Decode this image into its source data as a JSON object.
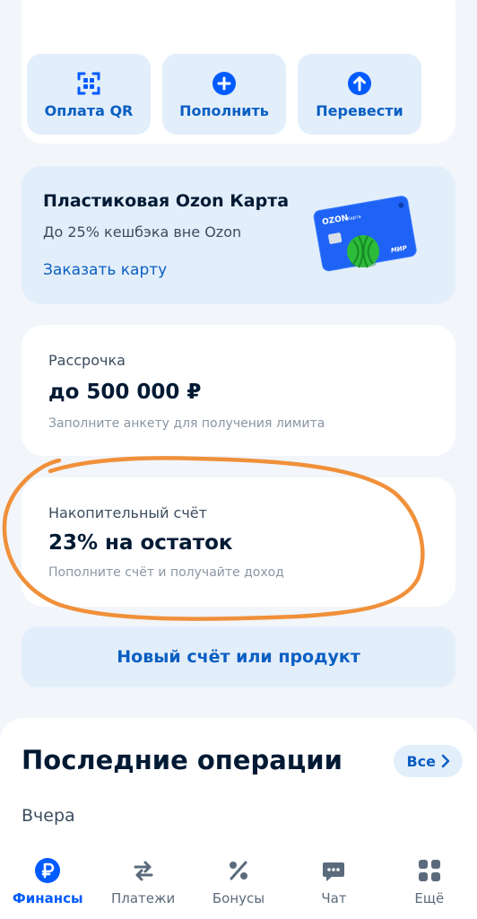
{
  "actions": [
    {
      "label": "Оплата QR",
      "icon": "qr-code-icon"
    },
    {
      "label": "Пополнить",
      "icon": "plus-circle-icon"
    },
    {
      "label": "Перевести",
      "icon": "arrow-up-circle-icon"
    }
  ],
  "promo": {
    "title": "Пластиковая Ozon Карта",
    "subtitle": "До 25% кешбэка вне Ozon",
    "link": "Заказать карту",
    "card_brand": "OZON",
    "card_label": "Карта",
    "card_network": "МИР"
  },
  "installment": {
    "label": "Рассрочка",
    "amount": "до 500 000 ₽",
    "hint": "Заполните анкету для получения лимита"
  },
  "savings": {
    "label": "Накопительный счёт",
    "rate": "23% на остаток",
    "hint": "Пополните счёт и получайте доход"
  },
  "new_product": "Новый счёт или продукт",
  "operations": {
    "title": "Последние операции",
    "all_label": "Все",
    "day": "Вчера"
  },
  "tabs": [
    {
      "label": "Финансы",
      "icon": "ruble-icon",
      "active": true
    },
    {
      "label": "Платежи",
      "icon": "transfer-arrows-icon",
      "active": false
    },
    {
      "label": "Бонусы",
      "icon": "percent-icon",
      "active": false
    },
    {
      "label": "Чат",
      "icon": "chat-icon",
      "active": false
    },
    {
      "label": "Ещё",
      "icon": "grid-icon",
      "active": false
    }
  ],
  "colors": {
    "accent": "#005bff",
    "link": "#0a5fc2",
    "tile_bg": "#e3eefb",
    "highlight": "#f0903a"
  }
}
